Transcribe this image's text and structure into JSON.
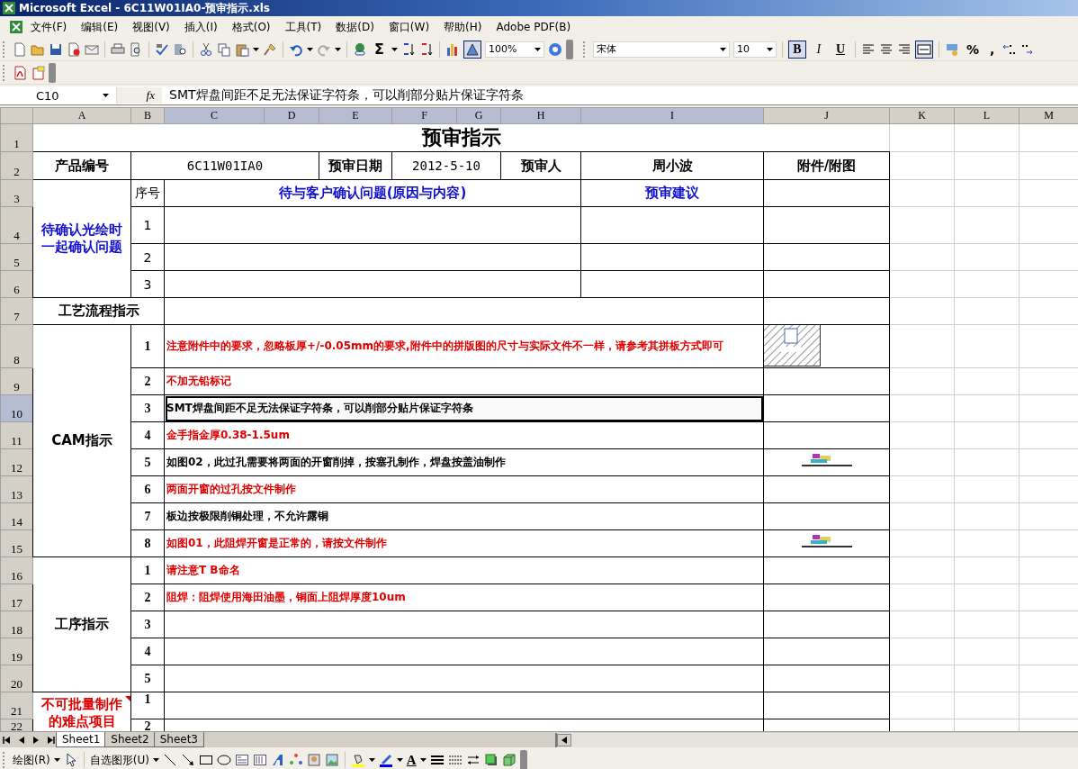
{
  "window": {
    "title": "Microsoft Excel - 6C11W01IA0-预审指示.xls"
  },
  "menu": [
    "文件(F)",
    "编辑(E)",
    "视图(V)",
    "插入(I)",
    "格式(O)",
    "工具(T)",
    "数据(D)",
    "窗口(W)",
    "帮助(H)",
    "Adobe PDF(B)"
  ],
  "standard_toolbar": {
    "autosum": "Σ",
    "zoom": "100%",
    "drawing_selected": true
  },
  "formatting_toolbar": {
    "font": "宋体",
    "size": "10",
    "bold": {
      "label": "B",
      "selected": true
    },
    "italic": {
      "label": "I",
      "selected": false
    },
    "underline": {
      "label": "U",
      "selected": false
    },
    "merge_center_selected": true,
    "percent": "%",
    "comma": ","
  },
  "formula_bar": {
    "name_box": "C10",
    "fx": "fx",
    "formula": "SMT焊盘间距不足无法保证字符条，可以削部分贴片保证字符条"
  },
  "columns": [
    {
      "label": "A",
      "selected": false
    },
    {
      "label": "B",
      "selected": false
    },
    {
      "label": "C",
      "selected": true
    },
    {
      "label": "D",
      "selected": true
    },
    {
      "label": "E",
      "selected": true
    },
    {
      "label": "F",
      "selected": true
    },
    {
      "label": "G",
      "selected": true
    },
    {
      "label": "H",
      "selected": true
    },
    {
      "label": "I",
      "selected": true
    },
    {
      "label": "J",
      "selected": false
    },
    {
      "label": "K",
      "selected": false
    },
    {
      "label": "L",
      "selected": false
    },
    {
      "label": "M",
      "selected": false
    }
  ],
  "rows": [
    {
      "label": "1",
      "selected": false
    },
    {
      "label": "2",
      "selected": false
    },
    {
      "label": "3",
      "selected": false
    },
    {
      "label": "4",
      "selected": false
    },
    {
      "label": "5",
      "selected": false
    },
    {
      "label": "6",
      "selected": false
    },
    {
      "label": "7",
      "selected": false
    },
    {
      "label": "8",
      "selected": false
    },
    {
      "label": "9",
      "selected": false
    },
    {
      "label": "10",
      "selected": true
    },
    {
      "label": "11",
      "selected": false
    },
    {
      "label": "12",
      "selected": false
    },
    {
      "label": "13",
      "selected": false
    },
    {
      "label": "14",
      "selected": false
    },
    {
      "label": "15",
      "selected": false
    },
    {
      "label": "16",
      "selected": false
    },
    {
      "label": "17",
      "selected": false
    },
    {
      "label": "18",
      "selected": false
    },
    {
      "label": "19",
      "selected": false
    },
    {
      "label": "20",
      "selected": false
    },
    {
      "label": "21",
      "selected": false
    },
    {
      "label": "22",
      "selected": false
    }
  ],
  "sheet": {
    "title": "预审指示",
    "header": [
      "产品编号",
      "6C11W01IA0",
      "预审日期",
      "2012-5-10",
      "预审人",
      "周小波",
      "附件/附图"
    ],
    "confirm": {
      "label": "待确认光绘时一起确认问题",
      "seq_header": "序号",
      "question_header": "待与客户确认问题(原因与内容)",
      "suggestion_header": "预审建议",
      "numbers": [
        "1",
        "2",
        "3"
      ]
    },
    "process_label": "工艺流程指示",
    "groups": [
      {
        "label": "CAM指示",
        "color": "#000000",
        "comment": false,
        "items": [
          {
            "kind": "object",
            "no": "1",
            "text": "注意附件中的要求，忽略板厚+/-0.05mm的要求,附件中的拼版图的尺寸与实际文件不一样，请参考其拼板方式即可",
            "color": "#e00000",
            "selected": false
          },
          {
            "kind": "plain",
            "no": "2",
            "text": "不加无铅标记",
            "color": "#e00000",
            "selected": false
          },
          {
            "kind": "plain",
            "no": "3",
            "text": "SMT焊盘间距不足无法保证字符条，可以削部分贴片保证字符条",
            "color": "#000000",
            "selected": true
          },
          {
            "kind": "plain",
            "no": "4",
            "text": "金手指金厚0.38-1.5um",
            "color": "#e00000",
            "selected": false
          },
          {
            "kind": "picture",
            "no": "5",
            "text": "如图02，此过孔需要将两面的开窗削掉，按塞孔制作，焊盘按盖油制作",
            "color": "#000000",
            "selected": false
          },
          {
            "kind": "plain",
            "no": "6",
            "text": "两面开窗的过孔按文件制作",
            "color": "#e00000",
            "selected": false
          },
          {
            "kind": "plain",
            "no": "7",
            "text": "板边按极限削铜处理，不允许露铜",
            "color": "#000000",
            "selected": false
          },
          {
            "kind": "picture",
            "no": "8",
            "text": "如图01，此阻焊开窗是正常的，请按文件制作",
            "color": "#e00000",
            "selected": false
          }
        ]
      },
      {
        "label": "工序指示",
        "color": "#000000",
        "comment": false,
        "items": [
          {
            "kind": "plain",
            "no": "1",
            "text": "请注意T B命名",
            "color": "#e00000",
            "selected": false
          },
          {
            "kind": "plain",
            "no": "2",
            "text": "阻焊：阻焊使用海田油墨，铜面上阻焊厚度10um",
            "color": "#e00000",
            "selected": false
          },
          {
            "kind": "plain",
            "no": "3",
            "selected": false
          },
          {
            "kind": "plain",
            "no": "4",
            "selected": false
          },
          {
            "kind": "plain",
            "no": "5",
            "selected": false
          }
        ]
      },
      {
        "label": "不可批量制作的难点项目",
        "color": "#e00000",
        "comment": true,
        "items": [
          {
            "kind": "plain",
            "no": "1",
            "selected": false
          },
          {
            "kind": "plain",
            "no": "2",
            "selected": false
          }
        ]
      }
    ]
  },
  "sheet_tabs": [
    {
      "label": "Sheet1",
      "selected": true
    },
    {
      "label": "Sheet2",
      "selected": false
    },
    {
      "label": "Sheet3",
      "selected": false
    }
  ],
  "drawing_toolbar": {
    "draw": "绘图(R)",
    "autoshapes": "自选图形(U)",
    "font_color": "A"
  }
}
